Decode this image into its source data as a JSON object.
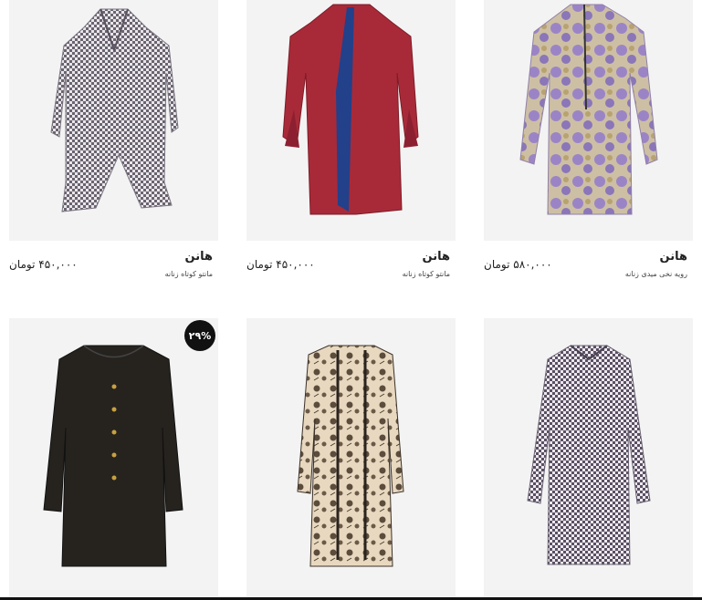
{
  "products": [
    {
      "brand": "هانن",
      "subtitle": "مانتو کوتاه زنانه",
      "price": "۴۵۰,۰۰۰ تومان",
      "image": "gray-houndstooth-coat-icon"
    },
    {
      "brand": "هانن",
      "subtitle": "مانتو کوتاه زنانه",
      "price": "۴۵۰,۰۰۰ تومان",
      "image": "red-coat-icon"
    },
    {
      "brand": "هانن",
      "subtitle": "رویه نخی میدی زنانه",
      "price": "۵۸۰,۰۰۰ تومان",
      "image": "purple-floral-coat-icon"
    },
    {
      "badge": "۲۹%",
      "image": "black-coat-icon"
    },
    {
      "image": "beige-floral-coat-icon"
    },
    {
      "image": "houndstooth-coat-icon"
    }
  ],
  "colors": {
    "card_bg": "#f3f3f3",
    "badge_bg": "#111111"
  }
}
